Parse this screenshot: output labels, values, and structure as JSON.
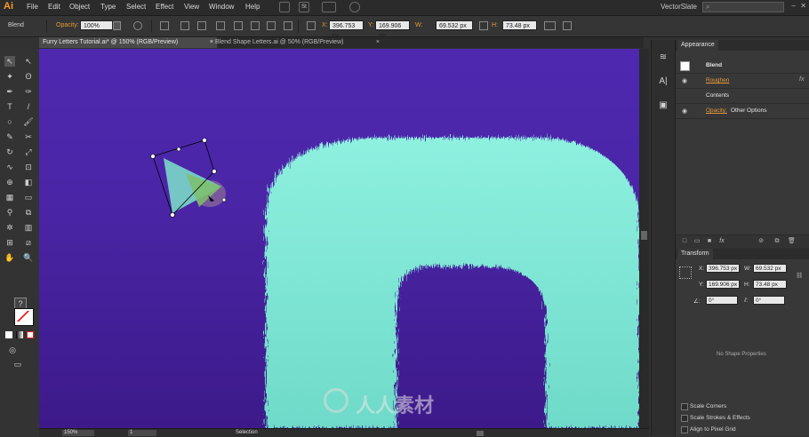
{
  "app": {
    "logo": "Ai",
    "workspace": "VectorSlate"
  },
  "menu": [
    "File",
    "Edit",
    "Object",
    "Type",
    "Select",
    "Effect",
    "View",
    "Window",
    "Help"
  ],
  "menubar_icons": {
    "st_label": "St"
  },
  "control": {
    "selection_type": "Blend",
    "opacity_label": "Opacity:",
    "opacity_value": "100%",
    "x_label": "X:",
    "x_value": "396.753 px",
    "y_label": "Y:",
    "y_value": "169.906 px",
    "w_label": "W:",
    "w_value": "69.532 px",
    "h_label": "H:",
    "h_value": "73.48 px"
  },
  "tabs": [
    {
      "label": "Furry Letters Tutorial.ai* @ 150% (RGB/Preview)",
      "close": "×"
    },
    {
      "label": "Blend Shape Letters.ai @ 50% (RGB/Preview)",
      "close": "×"
    }
  ],
  "status": {
    "zoom": "150%",
    "page": "1",
    "mode": "Selection"
  },
  "appearance": {
    "title": "Appearance",
    "rows": [
      {
        "label": "Blend"
      },
      {
        "label": "Roughen"
      },
      {
        "label": "Contents"
      },
      {
        "label": "Opacity:",
        "value": "Other Options"
      }
    ],
    "fx": "fx"
  },
  "transform": {
    "title": "Transform",
    "x_label": "X:",
    "x_value": "396.753 px",
    "y_label": "Y:",
    "y_value": "169.906 px",
    "w_label": "W:",
    "w_value": "69.532 px",
    "h_label": "H:",
    "h_value": "73.48 px",
    "angle_label": "∠:",
    "angle_value": "0°",
    "shear_label": "⫽:",
    "shear_value": "0°",
    "no_shape": "No Shape Properties",
    "options": [
      "Scale Corners",
      "Scale Strokes & Effects",
      "Align to Pixel Grid"
    ]
  },
  "watermark": "人人素材",
  "colors": {
    "fur": "#7de3d2",
    "canvas": "#4a25a6",
    "accent": "#e39a3a"
  }
}
